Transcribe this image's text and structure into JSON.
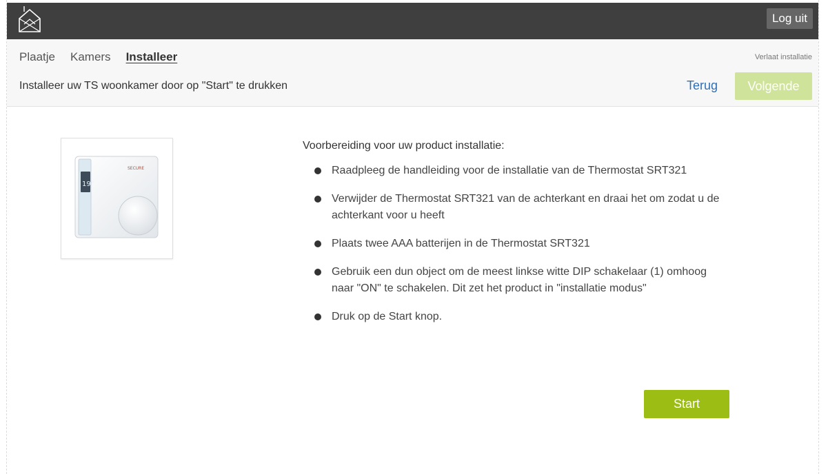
{
  "header": {
    "logout_label": "Log uit"
  },
  "nav": {
    "tabs": [
      {
        "label": "Plaatje"
      },
      {
        "label": "Kamers"
      },
      {
        "label": "Installeer",
        "active": true
      }
    ],
    "leave_label": "Verlaat installatie"
  },
  "wizard": {
    "instruction": "Installeer uw TS woonkamer door op \"Start\" te drukken",
    "back_label": "Terug",
    "next_label": "Volgende"
  },
  "product": {
    "device_brand": "SECURE",
    "display_value": "19°"
  },
  "prep": {
    "intro": "Voorbereiding voor uw product installatie:",
    "steps": [
      "Raadpleeg de handleiding voor de installatie van de Thermostat SRT321",
      "Verwijder de Thermostat SRT321 van de achterkant en draai het om zodat u de achterkant voor u heeft",
      "Plaats twee AAA batterijen in de Thermostat SRT321",
      "Gebruik een dun object om de meest linkse witte DIP schakelaar (1) omhoog naar \"ON\" te schakelen. Dit zet het product in \"installatie modus\"",
      "Druk op de Start knop."
    ],
    "start_label": "Start"
  },
  "colors": {
    "topbar": "#3f3f3f",
    "accent_green": "#9bbd14",
    "disabled_green": "#cfe39b",
    "link_blue": "#2f6fb5"
  },
  "icons": {
    "logo": "home-logo-icon",
    "bullet": "bullet-icon"
  }
}
